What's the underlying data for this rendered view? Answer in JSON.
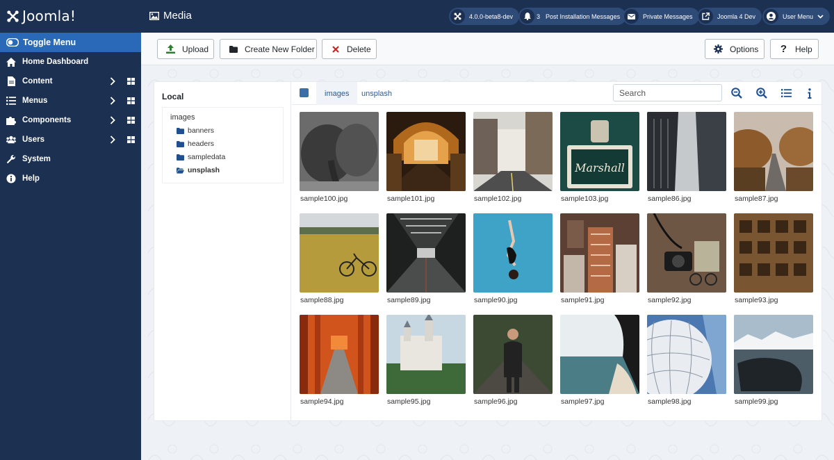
{
  "brand": {
    "name": "Joomla!"
  },
  "sidebar": {
    "toggle_label": "Toggle Menu",
    "items": [
      {
        "label": "Home Dashboard",
        "icon": "home-icon",
        "submenu": false
      },
      {
        "label": "Content",
        "icon": "file-icon",
        "submenu": true
      },
      {
        "label": "Menus",
        "icon": "list-icon",
        "submenu": true
      },
      {
        "label": "Components",
        "icon": "puzzle-icon",
        "submenu": true
      },
      {
        "label": "Users",
        "icon": "users-icon",
        "submenu": true
      },
      {
        "label": "System",
        "icon": "wrench-icon",
        "submenu": false
      },
      {
        "label": "Help",
        "icon": "info-icon",
        "submenu": false
      }
    ]
  },
  "header": {
    "title": "Media",
    "version": "4.0.0-beta8-dev",
    "post_install_count": "3",
    "post_install_label": "Post Installation Messages",
    "private_messages_label": "Private Messages",
    "site_label": "Joomla 4 Dev",
    "user_menu_label": "User Menu"
  },
  "toolbar": {
    "upload_label": "Upload",
    "new_folder_label": "Create New Folder",
    "delete_label": "Delete",
    "options_label": "Options",
    "help_label": "Help"
  },
  "tree": {
    "adapter_title": "Local",
    "root": "images",
    "folders": [
      "banners",
      "headers",
      "sampledata",
      "unsplash"
    ],
    "active_folder": "unsplash"
  },
  "browser": {
    "breadcrumb": [
      "images",
      "unsplash"
    ],
    "search_placeholder": "Search",
    "files": [
      "sample100.jpg",
      "sample101.jpg",
      "sample102.jpg",
      "sample103.jpg",
      "sample86.jpg",
      "sample87.jpg",
      "sample88.jpg",
      "sample89.jpg",
      "sample90.jpg",
      "sample91.jpg",
      "sample92.jpg",
      "sample93.jpg",
      "sample94.jpg",
      "sample95.jpg",
      "sample96.jpg",
      "sample97.jpg",
      "sample98.jpg",
      "sample99.jpg"
    ]
  },
  "colors": {
    "sidebar_bg": "#1c3052",
    "toggle_active": "#2a69b8",
    "header_pill": "#2e4a77",
    "upload_green": "#2f7d32",
    "delete_red": "#c52827",
    "link_blue": "#2a5a93"
  }
}
